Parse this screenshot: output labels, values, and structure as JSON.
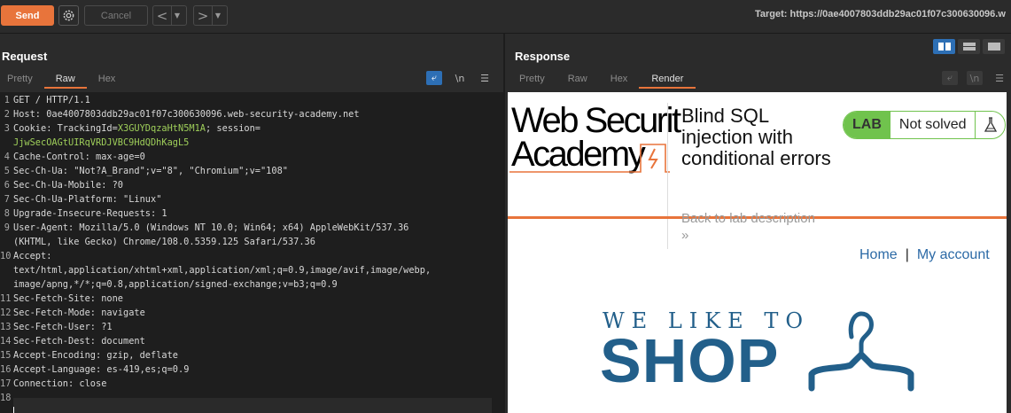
{
  "toolbar": {
    "send_label": "Send",
    "cancel_label": "Cancel",
    "target": "Target: https://0ae4007803ddb29ac01f07c300630096.w"
  },
  "request": {
    "title": "Request",
    "tabs": [
      "Pretty",
      "Raw",
      "Hex"
    ],
    "active_tab": "Raw",
    "newline_label": "\\n",
    "line_numbers": [
      "1",
      "2",
      "3",
      "",
      "4",
      "5",
      "6",
      "7",
      "8",
      "9",
      "",
      "10",
      "",
      "",
      "11",
      "12",
      "13",
      "14",
      "15",
      "16",
      "17",
      "18"
    ],
    "lines": [
      {
        "k": "GET / HTTP/1.1",
        "v": ""
      },
      {
        "k": "Host:",
        "v": " 0ae4007803ddb29ac01f07c300630096.web-security-academy.net"
      },
      {
        "k": "Cookie:",
        "v": " TrackingId=",
        "c1": "X3GUYDqzaHtN5M1A",
        "v2": "; session=",
        "c2": ""
      },
      {
        "k": "",
        "v": "",
        "c1": "JjwSecOAGtUIRqVRDJVBC9HdQDhKagL5"
      },
      {
        "k": "Cache-Control:",
        "v": " max-age=0"
      },
      {
        "k": "Sec-Ch-Ua:",
        "v": " \"Not?A_Brand\";v=\"8\", \"Chromium\";v=\"108\""
      },
      {
        "k": "Sec-Ch-Ua-Mobile:",
        "v": " ?0"
      },
      {
        "k": "Sec-Ch-Ua-Platform:",
        "v": " \"Linux\""
      },
      {
        "k": "Upgrade-Insecure-Requests:",
        "v": " 1"
      },
      {
        "k": "User-Agent:",
        "v": " Mozilla/5.0 (Windows NT 10.0; Win64; x64) AppleWebKit/537.36"
      },
      {
        "k": "",
        "v": "(KHTML, like Gecko) Chrome/108.0.5359.125 Safari/537.36"
      },
      {
        "k": "Accept:",
        "v": ""
      },
      {
        "k": "",
        "v": "text/html,application/xhtml+xml,application/xml;q=0.9,image/avif,image/webp,"
      },
      {
        "k": "",
        "v": "image/apng,*/*;q=0.8,application/signed-exchange;v=b3;q=0.9"
      },
      {
        "k": "Sec-Fetch-Site:",
        "v": " none"
      },
      {
        "k": "Sec-Fetch-Mode:",
        "v": " navigate"
      },
      {
        "k": "Sec-Fetch-User:",
        "v": " ?1"
      },
      {
        "k": "Sec-Fetch-Dest:",
        "v": " document"
      },
      {
        "k": "Accept-Encoding:",
        "v": " gzip, deflate"
      },
      {
        "k": "Accept-Language:",
        "v": " es-419,es;q=0.9"
      },
      {
        "k": "Connection:",
        "v": " close"
      },
      {
        "k": "",
        "v": ""
      }
    ]
  },
  "response": {
    "title": "Response",
    "tabs": [
      "Pretty",
      "Raw",
      "Hex",
      "Render"
    ],
    "active_tab": "Render",
    "newline_label": "\\n",
    "page": {
      "logo_line1": "Web Securit",
      "logo_line2": "Academy",
      "lab_title": "Blind SQL injection with conditional errors",
      "back_link": "Back to lab description",
      "chevrons": "»",
      "lab_badge": "LAB",
      "status": "Not solved",
      "nav_home": "Home",
      "nav_sep": "|",
      "nav_account": "My account",
      "banner_small": "WE LIKE TO",
      "banner_big": "SHOP"
    }
  },
  "colors": {
    "accent": "#e8743b",
    "brand_blue": "#225f8a",
    "lab_green": "#70c34d",
    "cookie_value": "#9fcf5a"
  }
}
